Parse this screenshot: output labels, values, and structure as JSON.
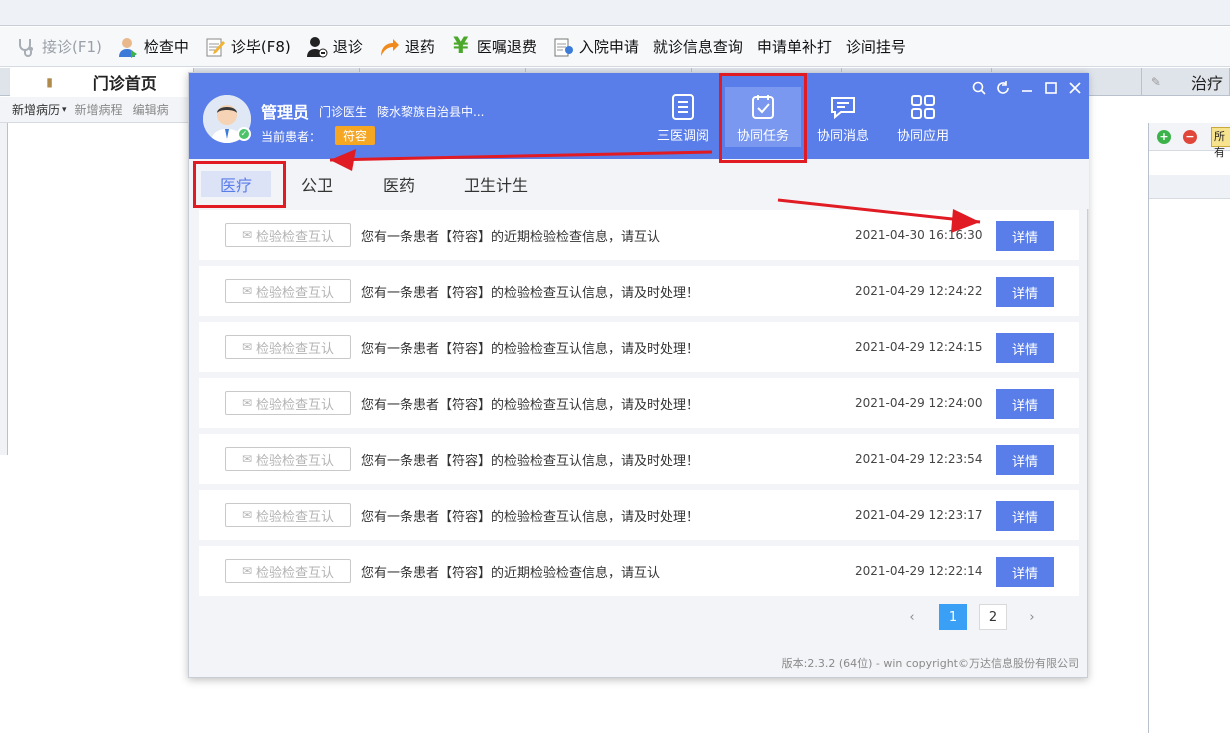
{
  "toolbar": {
    "items": [
      {
        "label": "接诊(F1)",
        "icon": "stethoscope-icon",
        "disabled": true
      },
      {
        "label": "检查中",
        "icon": "doctor-icon"
      },
      {
        "label": "诊毕(F8)",
        "icon": "notepad-icon"
      },
      {
        "label": "退诊",
        "icon": "person-minus-icon"
      },
      {
        "label": "退药",
        "icon": "return-arrow-icon"
      },
      {
        "label": "医嘱退费",
        "icon": "yen-icon"
      },
      {
        "label": "入院申请",
        "icon": "admission-icon"
      },
      {
        "label": "就诊信息查询",
        "icon": ""
      },
      {
        "label": "申请单补打",
        "icon": ""
      },
      {
        "label": "诊间挂号",
        "icon": ""
      }
    ]
  },
  "bg_tabs": {
    "home": "门诊首页",
    "treatment": "治疗"
  },
  "subbar": {
    "new_record": "新增病历",
    "new_course": "新增病程",
    "edit_record": "编辑病"
  },
  "right_panel": {
    "all_label": "所有"
  },
  "popup": {
    "user_name": "管理员",
    "user_role": "门诊医生",
    "hospital": "陵水黎族自治县中...",
    "current_patient_label": "当前患者：",
    "current_patient": "符容",
    "nav": [
      {
        "label": "三医调阅",
        "icon": "document-list-icon"
      },
      {
        "label": "协同任务",
        "icon": "task-check-icon",
        "active": true
      },
      {
        "label": "协同消息",
        "icon": "chat-bubble-icon"
      },
      {
        "label": "协同应用",
        "icon": "grid-apps-icon"
      }
    ],
    "tabs": [
      "医疗",
      "公卫",
      "医药",
      "卫生计生"
    ],
    "active_tab": "医疗",
    "badge_label": "检验检查互认",
    "detail_label": "详情",
    "messages": [
      {
        "text": "您有一条患者【符容】的近期检验检查信息，请互认",
        "time": "2021-04-30 16:16:30"
      },
      {
        "text": "您有一条患者【符容】的检验检查互认信息，请及时处理！",
        "time": "2021-04-29 12:24:22"
      },
      {
        "text": "您有一条患者【符容】的检验检查互认信息，请及时处理！",
        "time": "2021-04-29 12:24:15"
      },
      {
        "text": "您有一条患者【符容】的检验检查互认信息，请及时处理！",
        "time": "2021-04-29 12:24:00"
      },
      {
        "text": "您有一条患者【符容】的检验检查互认信息，请及时处理！",
        "time": "2021-04-29 12:23:54"
      },
      {
        "text": "您有一条患者【符容】的检验检查互认信息，请及时处理！",
        "time": "2021-04-29 12:23:17"
      },
      {
        "text": "您有一条患者【符容】的近期检验检查信息，请互认",
        "time": "2021-04-29 12:22:14"
      }
    ],
    "pagination": {
      "prev": "‹",
      "pages": [
        "1",
        "2"
      ],
      "current": "1",
      "next": "›"
    },
    "footer": "版本:2.3.2 (64位) - win   copyright©万达信息股份有限公司"
  },
  "colors": {
    "header_blue": "#5a7ee9",
    "button_blue": "#5a7ee9",
    "patient_badge": "#f5a623",
    "annotation_red": "#e01b24",
    "page_current": "#3aa0f5"
  }
}
